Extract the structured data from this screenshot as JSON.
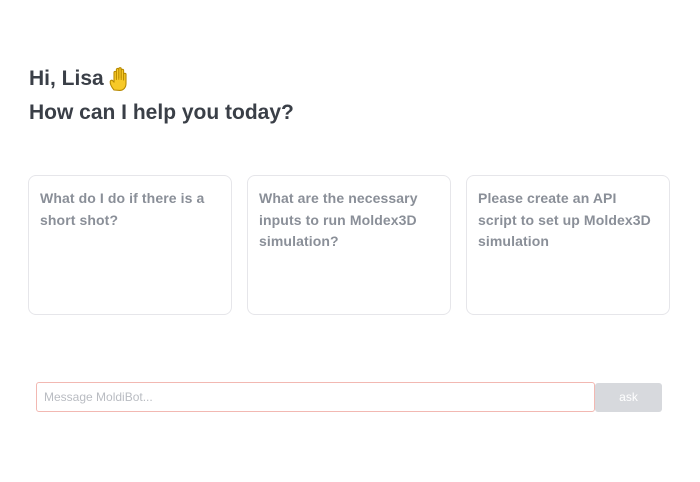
{
  "header": {
    "greeting": "Hi, Lisa",
    "greeting_icon": "raised-hand-icon",
    "subtitle": "How can I help you today?"
  },
  "suggestions": [
    {
      "text": "What do I do if there is a short shot?"
    },
    {
      "text": "What are the necessary inputs to run Moldex3D simulation?"
    },
    {
      "text": "Please create an API script to set up Moldex3D simulation"
    }
  ],
  "composer": {
    "placeholder": "Message MoldiBot...",
    "value": "",
    "ask_label": "ask"
  },
  "colors": {
    "heading": "#3a3f47",
    "card_text": "#8a8f98",
    "card_border": "#e6e6ea",
    "input_border": "#f2b8b2",
    "button_bg": "#d7d9dd",
    "hand_fill": "#f7c928"
  }
}
